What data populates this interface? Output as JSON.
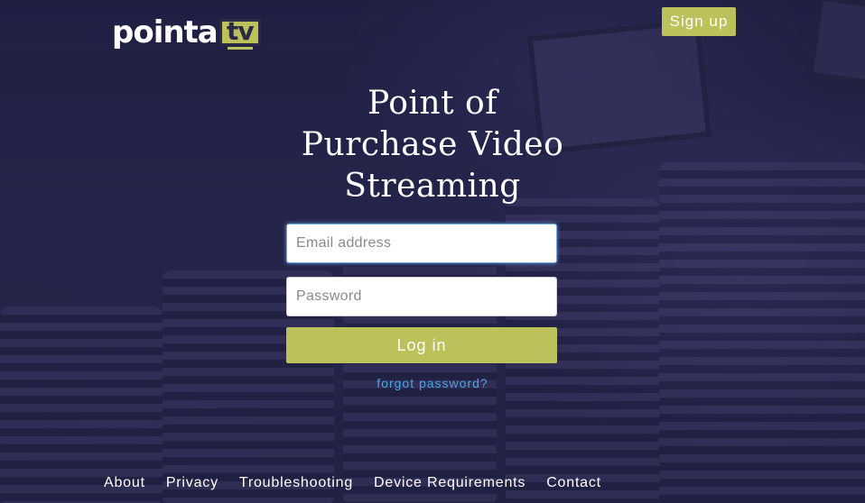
{
  "brand": {
    "logo_word": "pointa",
    "logo_box": "tv"
  },
  "header": {
    "signup_label": "Sign up"
  },
  "hero": {
    "title_lines": [
      "Point of",
      "Purchase Video",
      "Streaming"
    ]
  },
  "login_form": {
    "email_placeholder": "Email address",
    "email_value": "",
    "password_placeholder": "Password",
    "password_value": "",
    "login_label": "Log in",
    "forgot_label": "forgot password?"
  },
  "footer": {
    "links": [
      "About",
      "Privacy",
      "Troubleshooting",
      "Device Requirements",
      "Contact"
    ]
  },
  "colors": {
    "accent": "#bcc15b",
    "link": "#4aa6e0",
    "background": "#25244a"
  }
}
